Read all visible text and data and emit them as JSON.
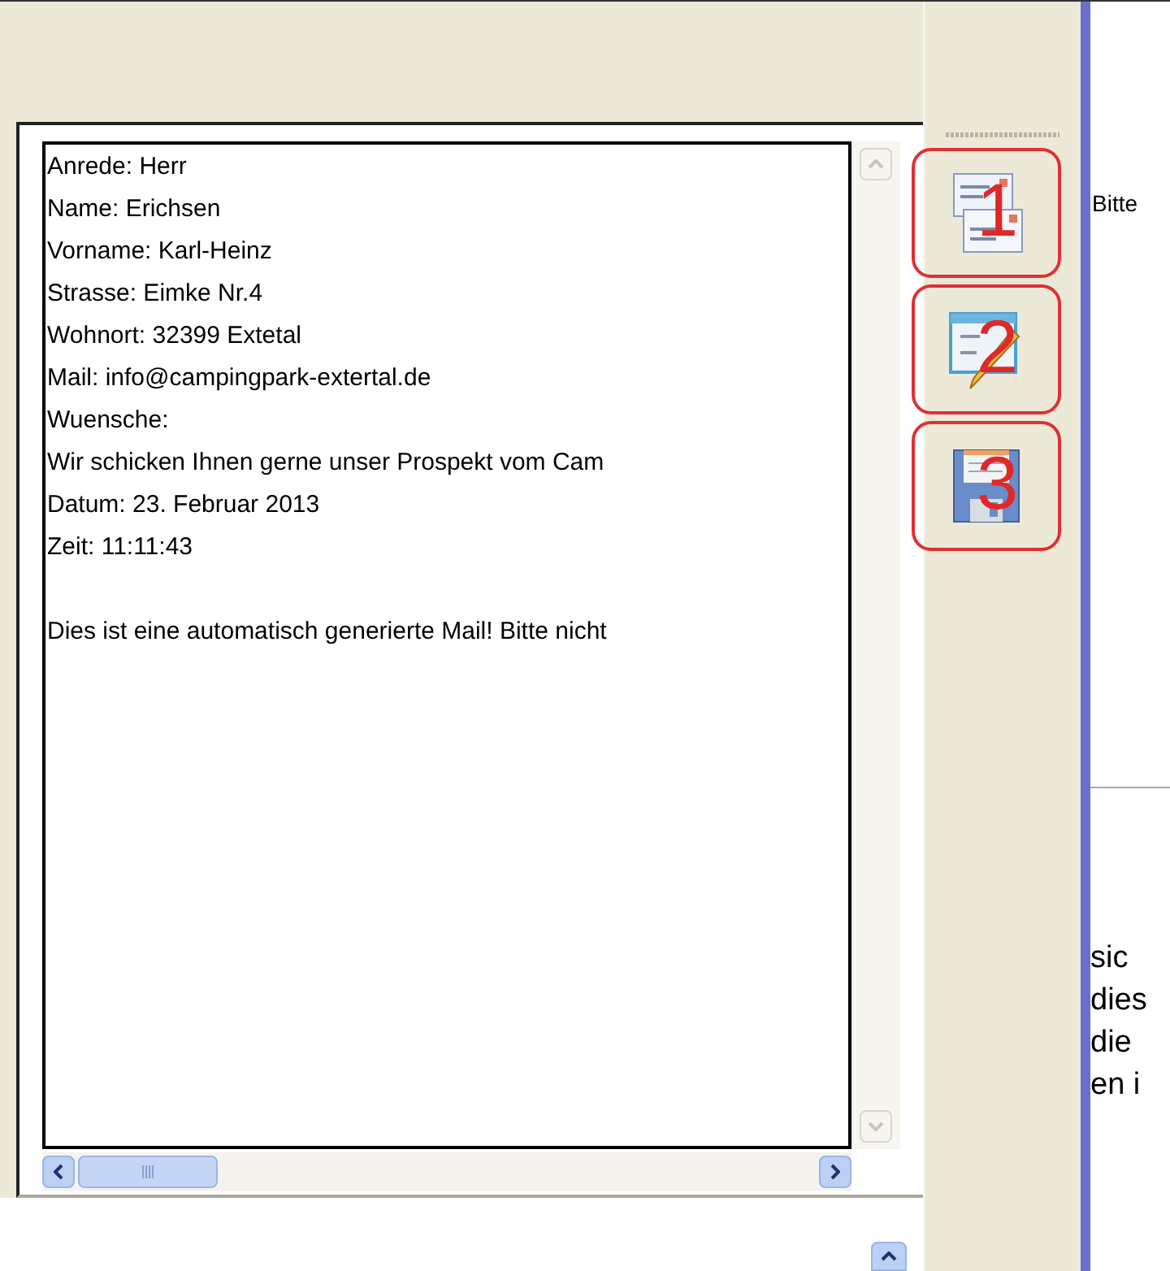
{
  "text_area": {
    "lines": [
      "Anrede: Herr",
      "Name: Erichsen",
      "Vorname: Karl-Heinz",
      "Strasse: Eimke Nr.4",
      "Wohnort: 32399 Extetal",
      "Mail: info@campingpark-extertal.de",
      "Wuensche:",
      "Wir schicken Ihnen gerne unser Prospekt vom Cam",
      "Datum: 23. Februar 2013",
      "Zeit: 11:11:43"
    ],
    "footer": "Dies ist eine automatisch generierte Mail! Bitte nicht"
  },
  "toolbar": {
    "buttons": [
      {
        "kind": "envelopes",
        "annotation": "1"
      },
      {
        "kind": "edit",
        "annotation": "2"
      },
      {
        "kind": "save",
        "annotation": "3"
      }
    ]
  },
  "right_pane": {
    "top_text": "Bitte",
    "lines": [
      "sic",
      "dies",
      "die",
      "en i"
    ]
  }
}
